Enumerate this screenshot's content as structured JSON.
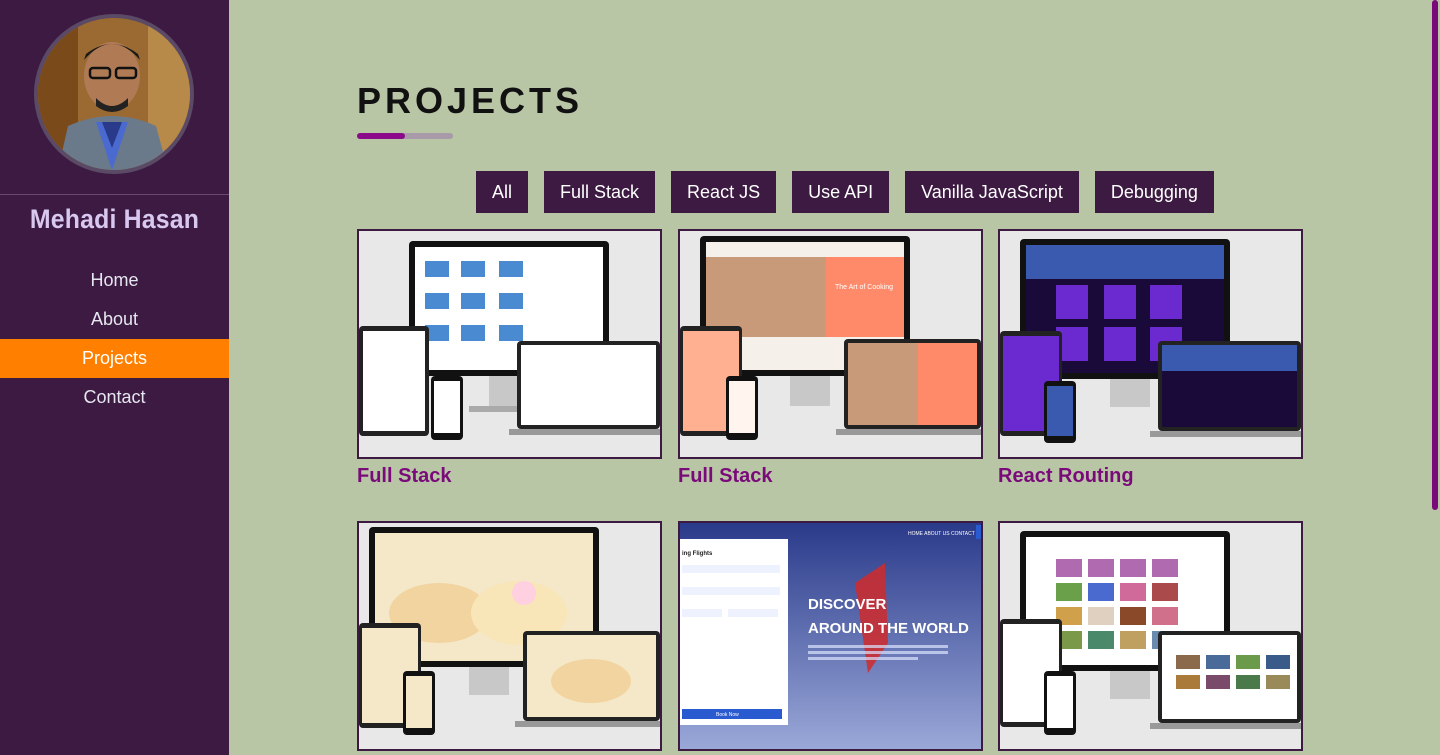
{
  "sidebar": {
    "name": "Mehadi Hasan",
    "nav": [
      "Home",
      "About",
      "Projects",
      "Contact"
    ],
    "active": "Projects"
  },
  "main": {
    "title": "PROJECTS",
    "filters": [
      "All",
      "Full Stack",
      "React JS",
      "Use API",
      "Vanilla JavaScript",
      "Debugging"
    ],
    "projects": [
      {
        "caption": "Full Stack",
        "theme": "laptops"
      },
      {
        "caption": "Full Stack",
        "theme": "cooking"
      },
      {
        "caption": "React Routing",
        "theme": "football"
      },
      {
        "caption": "",
        "theme": "cakes"
      },
      {
        "caption": "",
        "theme": "flights"
      },
      {
        "caption": "",
        "theme": "gallery"
      }
    ]
  },
  "flights_screen": {
    "nav": "HOME   ABOUT US   CONTACT",
    "headline_1": "DISCOVER",
    "headline_2": "AROUND THE WORLD",
    "form_title": "ing Flights",
    "button": "Book Now"
  },
  "cooking_screen": {
    "banner": "The Art of Cooking"
  },
  "colors": {
    "sidebar": "#3d1a42",
    "background": "#b8c6a6",
    "accent": "#ff7f00",
    "caption": "#7a0a7a"
  }
}
